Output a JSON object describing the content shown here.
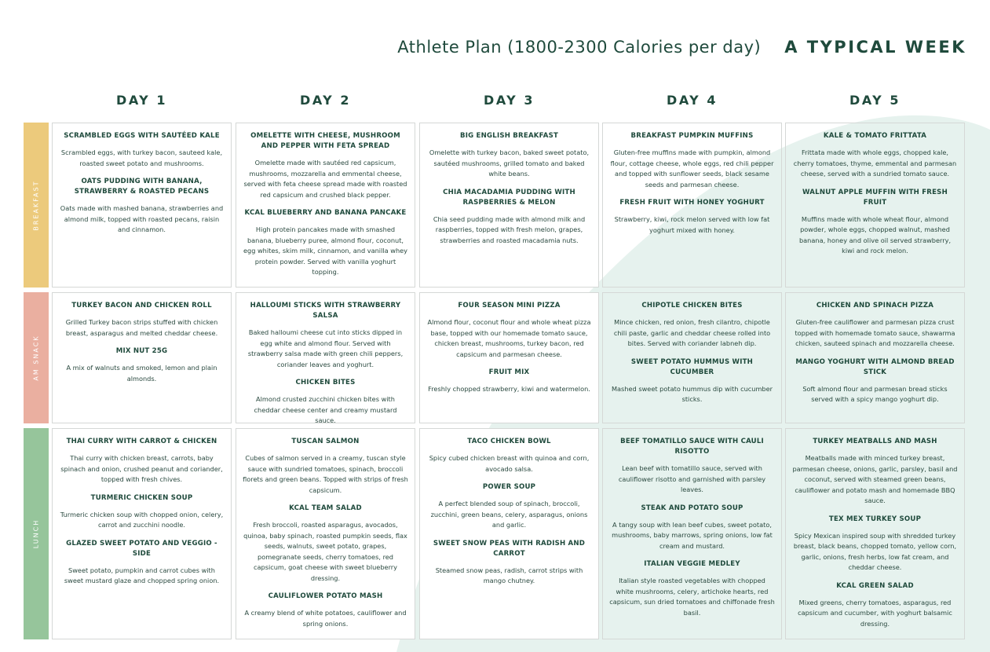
{
  "header": {
    "subtitle": "Athlete Plan (1800-2300 Calories per day)",
    "title": "A TYPICAL WEEK"
  },
  "days": [
    "DAY 1",
    "DAY 2",
    "DAY 3",
    "DAY 4",
    "DAY 5"
  ],
  "colors": {
    "breakfast": "#ecca7c",
    "am_snack": "#eaafa0",
    "lunch": "#96c59b",
    "text": "#1f4a3c",
    "background_shape": "#e6f2ee"
  },
  "meals": [
    {
      "label": "BREAKFAST",
      "cells": [
        [
          {
            "title": "SCRAMBLED EGGS WITH SAUTÉED KALE",
            "desc": "Scrambled eggs, with turkey bacon, sauteed kale, roasted sweet potato and mushrooms."
          },
          {
            "title": "OATS PUDDING WITH BANANA, STRAWBERRY & ROASTED PECANS",
            "desc": "Oats made with mashed banana, strawberries and almond milk, topped with roasted pecans, raisin and cinnamon."
          }
        ],
        [
          {
            "title": "OMELETTE WITH CHEESE, MUSHROOM AND PEPPER WITH FETA SPREAD",
            "desc": "Omelette made with sautéed red capsicum, mushrooms, mozzarella and emmental cheese, served with feta cheese spread made with roasted red capsicum and crushed black pepper."
          },
          {
            "title": "KCAL BLUEBERRY AND BANANA PANCAKE",
            "desc": "High protein pancakes made with smashed banana, blueberry puree, almond flour, coconut, egg whites, skim milk, cinnamon, and vanilla whey protein powder. Served with vanilla yoghurt topping."
          }
        ],
        [
          {
            "title": "BIG ENGLISH BREAKFAST",
            "desc": "Omelette with turkey bacon, baked sweet potato, sautéed mushrooms, grilled tomato and baked white beans."
          },
          {
            "title": "CHIA MACADAMIA PUDDING WITH RASPBERRIES & MELON",
            "desc": "Chia seed pudding made with almond milk and raspberries, topped with fresh melon, grapes, strawberries and roasted macadamia nuts."
          }
        ],
        [
          {
            "title": "BREAKFAST PUMPKIN MUFFINS",
            "desc": "Gluten-free muffins made with pumpkin, almond flour, cottage cheese, whole eggs, red chili pepper and topped with sunflower seeds, black sesame seeds and parmesan cheese."
          },
          {
            "title": "FRESH FRUIT WITH HONEY YOGHURT",
            "desc": "Strawberry, kiwi, rock melon served with low fat yoghurt mixed with honey."
          }
        ],
        [
          {
            "title": "KALE & TOMATO FRITTATA",
            "desc": "Frittata made with whole eggs, chopped kale, cherry tomatoes, thyme, emmental and parmesan cheese, served with a sundried tomato sauce."
          },
          {
            "title": "WALNUT APPLE MUFFIN WITH FRESH FRUIT",
            "desc": "Muffins made with whole wheat flour, almond powder, whole eggs, chopped walnut, mashed banana, honey and olive oil served strawberry, kiwi and rock melon."
          }
        ]
      ]
    },
    {
      "label": "AM SNACK",
      "cells": [
        [
          {
            "title": "TURKEY BACON AND CHICKEN ROLL",
            "desc": "Grilled Turkey bacon strips stuffed with chicken breast, asparagus and  melted cheddar cheese."
          },
          {
            "title": "MIX NUT 25G",
            "desc": "A mix of walnuts and smoked, lemon and plain almonds."
          }
        ],
        [
          {
            "title": "HALLOUMI STICKS WITH STRAWBERRY SALSA",
            "desc": "Baked halloumi cheese cut into sticks dipped in egg white and almond flour. Served with strawberry salsa made with green chili peppers, coriander leaves and yoghurt."
          },
          {
            "title": "CHICKEN BITES",
            "desc": "Almond crusted zucchini chicken bites with cheddar cheese center and  creamy mustard sauce."
          }
        ],
        [
          {
            "title": "FOUR SEASON MINI PIZZA",
            "desc": "Almond flour, coconut flour and whole wheat pizza base, topped with our homemade tomato sauce, chicken breast, mushrooms, turkey bacon, red capsicum and parmesan cheese."
          },
          {
            "title": "FRUIT MIX",
            "desc": "Freshly chopped strawberry, kiwi and watermelon."
          }
        ],
        [
          {
            "title": "CHIPOTLE CHICKEN BITES",
            "desc": "Mince chicken, red onion, fresh cilantro, chipotle chili paste, garlic and cheddar cheese rolled into bites. Served with coriander labneh dip."
          },
          {
            "title": "SWEET POTATO HUMMUS WITH CUCUMBER",
            "desc": "Mashed sweet potato hummus dip with cucumber sticks."
          }
        ],
        [
          {
            "title": "CHICKEN AND SPINACH PIZZA",
            "desc": "Gluten-free cauliflower and parmesan pizza crust topped with homemade tomato sauce, shawarma chicken, sauteed spinach and mozzarella cheese."
          },
          {
            "title": "MANGO YOGHURT WITH ALMOND BREAD STICK",
            "desc": "Soft almond flour and parmesan bread sticks served with a spicy mango yoghurt dip."
          }
        ]
      ]
    },
    {
      "label": "LUNCH",
      "cells": [
        [
          {
            "title": "THAI CURRY WITH CARROT & CHICKEN",
            "desc": "Thai curry with chicken breast, carrots, baby spinach and onion, crushed peanut and coriander, topped with fresh chives."
          },
          {
            "title": "TURMERIC CHICKEN SOUP",
            "desc": "Turmeric chicken soup with chopped onion, celery, carrot and zucchini noodle."
          },
          {
            "title": "GLAZED SWEET POTATO AND VEGGIO - SIDE",
            "desc": "Sweet potato, pumpkin and carrot cubes with sweet mustard glaze and chopped spring onion."
          }
        ],
        [
          {
            "title": "TUSCAN SALMON",
            "desc": "Cubes of salmon served in a creamy, tuscan style sauce with sundried tomatoes, spinach, broccoli florets and green beans. Topped with strips of fresh capsicum."
          },
          {
            "title": "KCAL TEAM SALAD",
            "desc": "Fresh broccoli, roasted asparagus, avocados, quinoa, baby spinach, roasted pumpkin seeds, flax seeds, walnuts, sweet potato, grapes, pomegranate seeds, cherry tomatoes, red capsicum, goat cheese with sweet blueberry dressing."
          },
          {
            "title": "CAULIFLOWER POTATO MASH",
            "desc": "A creamy blend of white potatoes, cauliflower and spring onions."
          }
        ],
        [
          {
            "title": "TACO CHICKEN BOWL",
            "desc": "Spicy cubed chicken breast with quinoa and corn, avocado salsa."
          },
          {
            "title": "POWER SOUP",
            "desc": "A perfect blended soup of spinach, broccoli, zucchini, green beans, celery, asparagus, onions and garlic."
          },
          {
            "title": "SWEET SNOW PEAS WITH RADISH AND CARROT",
            "desc": "Steamed snow peas, radish, carrot strips with mango chutney."
          }
        ],
        [
          {
            "title": "BEEF TOMATILLO SAUCE WITH CAULI RISOTTO",
            "desc": "Lean beef with tomatillo sauce, served with cauliflower risotto and garnished with parsley leaves."
          },
          {
            "title": "STEAK AND POTATO SOUP",
            "desc": "A tangy soup with lean beef cubes, sweet potato, mushrooms, baby marrows, spring onions, low fat cream and mustard."
          },
          {
            "title": "ITALIAN VEGGIE MEDLEY",
            "desc": "Italian style roasted vegetables with chopped white mushrooms, celery, artichoke hearts, red capsicum, sun dried tomatoes and chiffonade fresh basil."
          }
        ],
        [
          {
            "title": "TURKEY MEATBALLS AND MASH",
            "desc": "Meatballs made with minced turkey breast, parmesan cheese, onions, garlic, parsley, basil and coconut, served with steamed green beans, cauliflower and potato mash and homemade BBQ sauce."
          },
          {
            "title": "TEX MEX TURKEY SOUP",
            "desc": "Spicy Mexican inspired soup with shredded turkey breast, black beans, chopped tomato, yellow corn, garlic, onions, fresh herbs, low fat cream, and cheddar cheese."
          },
          {
            "title": "KCAL GREEN SALAD",
            "desc": "Mixed greens, cherry tomatoes, asparagus, red capsicum and cucumber, with yoghurt balsamic dressing."
          }
        ]
      ]
    }
  ]
}
